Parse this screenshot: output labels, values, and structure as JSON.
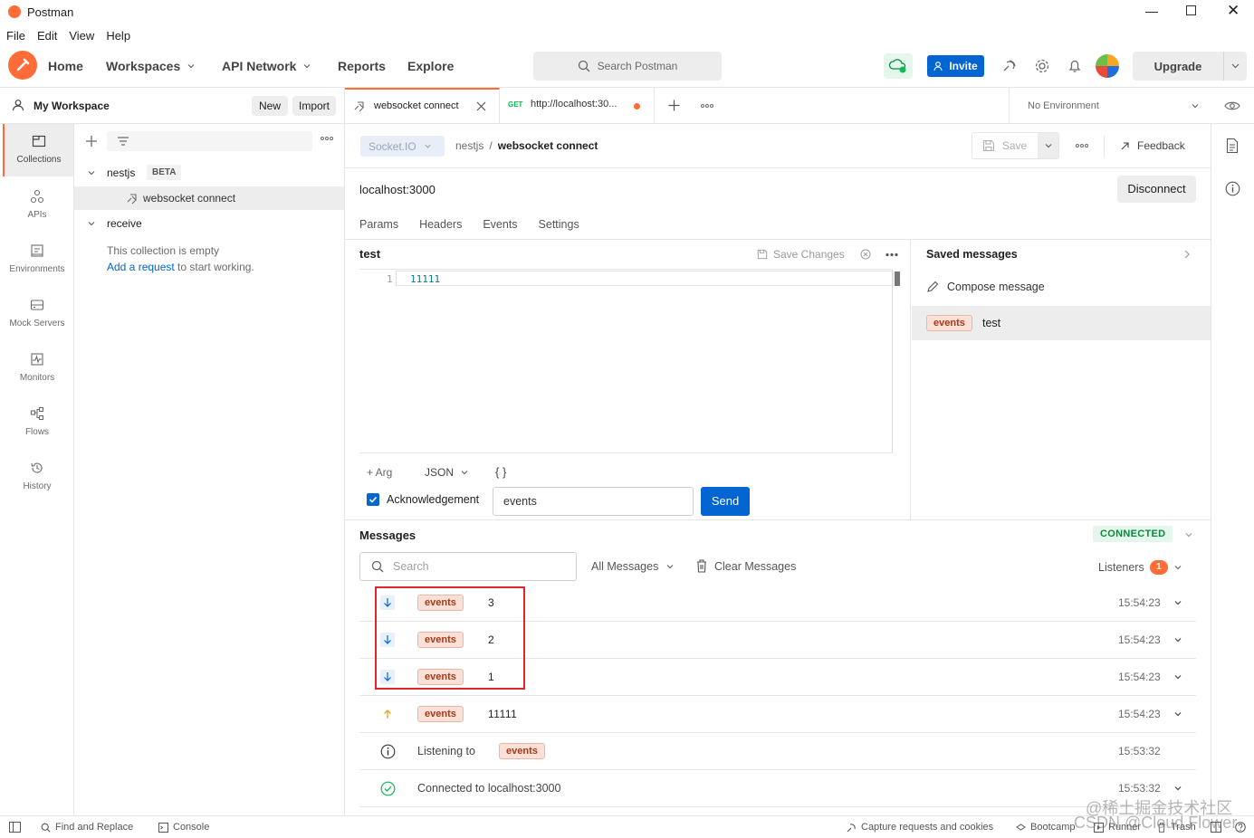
{
  "window": {
    "title": "Postman"
  },
  "menu": [
    "File",
    "Edit",
    "View",
    "Help"
  ],
  "topnav": {
    "home": "Home",
    "workspaces": "Workspaces",
    "api_network": "API Network",
    "reports": "Reports",
    "explore": "Explore",
    "search_placeholder": "Search Postman",
    "invite": "Invite",
    "upgrade": "Upgrade"
  },
  "workspace": {
    "name": "My Workspace",
    "new": "New",
    "import": "Import"
  },
  "sidebar_nav": [
    {
      "label": "Collections",
      "icon": "collections-icon"
    },
    {
      "label": "APIs",
      "icon": "apis-icon"
    },
    {
      "label": "Environments",
      "icon": "environments-icon"
    },
    {
      "label": "Mock Servers",
      "icon": "mock-servers-icon"
    },
    {
      "label": "Monitors",
      "icon": "monitors-icon"
    },
    {
      "label": "Flows",
      "icon": "flows-icon"
    },
    {
      "label": "History",
      "icon": "history-icon"
    }
  ],
  "tree": {
    "collection1": "nestjs",
    "beta_badge": "BETA",
    "item1": "websocket connect",
    "collection2": "receive",
    "empty_text": "This collection is empty",
    "add_link": "Add a request",
    "add_suffix": " to start working."
  },
  "tabs": {
    "tab1": "websocket connect",
    "tab2_method": "GET",
    "tab2": "http://localhost:30...",
    "environment": "No Environment"
  },
  "request": {
    "type": "Socket.IO",
    "breadcrumb_parent": "nestjs",
    "breadcrumb_sep": "/",
    "breadcrumb_name": "websocket connect",
    "save": "Save",
    "feedback": "Feedback",
    "url": "localhost:3000",
    "disconnect": "Disconnect",
    "subtabs": [
      "Params",
      "Headers",
      "Events",
      "Settings"
    ]
  },
  "editor": {
    "name": "test",
    "save_changes": "Save Changes",
    "line_number": "1",
    "code": "11111",
    "add_arg": "+ Arg",
    "format": "JSON",
    "braces": "{ }",
    "ack_label": "Acknowledgement",
    "event_value": "events",
    "send": "Send"
  },
  "saved": {
    "title": "Saved messages",
    "compose": "Compose message",
    "item_tag": "events",
    "item_name": "test"
  },
  "messages": {
    "title": "Messages",
    "status": "CONNECTED",
    "search_placeholder": "Search",
    "filter": "All Messages",
    "clear": "Clear Messages",
    "listeners": "Listeners",
    "listeners_count": "1",
    "rows": [
      {
        "dir": "in",
        "tag": "events",
        "text": "3",
        "time": "15:54:23",
        "chevron": true
      },
      {
        "dir": "in",
        "tag": "events",
        "text": "2",
        "time": "15:54:23",
        "chevron": true
      },
      {
        "dir": "in",
        "tag": "events",
        "text": "1",
        "time": "15:54:23",
        "chevron": true
      },
      {
        "dir": "out",
        "tag": "events",
        "text": "11111",
        "time": "15:54:23",
        "chevron": true
      },
      {
        "dir": "info",
        "text": "Listening to",
        "tag2": "events",
        "time": "15:53:32",
        "chevron": false
      },
      {
        "dir": "ok",
        "text": "Connected to localhost:3000",
        "time": "15:53:32",
        "chevron": true
      }
    ]
  },
  "statusbar": {
    "find": "Find and Replace",
    "console": "Console",
    "capture": "Capture requests and cookies",
    "bootcamp": "Bootcamp",
    "runner": "Runner",
    "trash": "Trash"
  },
  "watermark": {
    "line1": "@稀土掘金技术社区",
    "line2": "CSDN @Cloud Flower"
  },
  "colors": {
    "accent": "#ff6c37",
    "blue": "#0265d2",
    "connected": "#0cbb52"
  }
}
